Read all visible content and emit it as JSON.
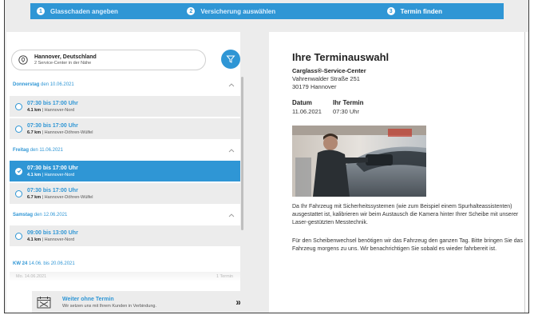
{
  "steps": [
    {
      "num": "1",
      "label": "Glasschaden angeben"
    },
    {
      "num": "2",
      "label": "Versicherung auswählen"
    },
    {
      "num": "3",
      "label": "Termin finden"
    }
  ],
  "location": {
    "title": "Hannover, Deutschland",
    "subtitle": "2 Service-Center in der Nähe"
  },
  "days": [
    {
      "day": "Donnerstag",
      "date": "den 10.06.2021",
      "slots": [
        {
          "time": "07:30 bis 17:00 Uhr",
          "distance": "4.1 km",
          "center": "| Hannover-Nord",
          "selected": false
        },
        {
          "time": "07:30 bis 17:00 Uhr",
          "distance": "6.7 km",
          "center": "| Hannover-Döhren-Wülfel",
          "selected": false
        }
      ]
    },
    {
      "day": "Freitag",
      "date": "den 11.06.2021",
      "slots": [
        {
          "time": "07:30 bis 17:00 Uhr",
          "distance": "4.1 km",
          "center": "| Hannover-Nord",
          "selected": true
        },
        {
          "time": "07:30 bis 17:00 Uhr",
          "distance": "6.7 km",
          "center": "| Hannover-Döhren-Wülfel",
          "selected": false
        }
      ]
    },
    {
      "day": "Samstag",
      "date": "den 12.06.2021",
      "slots": [
        {
          "time": "09:00 bis 13:00 Uhr",
          "distance": "4.1 km",
          "center": "| Hannover-Nord",
          "selected": false
        }
      ]
    }
  ],
  "week": {
    "label": "KW 24",
    "range": "14.06. bis 20.06.2021"
  },
  "faded_row": {
    "left": "Mo. 14.06.2021",
    "right": "1 Termin"
  },
  "weiter": {
    "title": "Weiter ohne Termin",
    "subtitle": "Wir setzen uns mit Ihrem Kunden in Verbindung.",
    "arrow": "»"
  },
  "summary": {
    "title": "Ihre Terminauswahl",
    "center_name": "Carglass®-Service-Center",
    "street": "Vahrenwalder Straße 251",
    "city": "30179 Hannover",
    "date_label": "Datum",
    "date_value": "11.06.2021",
    "time_label": "Ihr Termin",
    "time_value": "07:30 Uhr",
    "paragraph1": "Da Ihr Fahrzeug mit Sicherheitssystemen (wie zum Beispiel einem Spurhalteassistenten) ausgestattet ist, kalibrieren wir beim Austausch die Kamera hinter Ihrer Scheibe mit unserer Laser-gestützten Messtechnik.",
    "paragraph2": "Für den Scheibenwechsel benötigen wir das Fahrzeug den ganzen Tag. Bitte bringen Sie das Fahrzeug morgens zu uns. Wir benachrichtigen Sie sobald es wieder fahrbereit ist."
  },
  "colors": {
    "accent": "#2f96d5",
    "panel": "#ececec"
  }
}
